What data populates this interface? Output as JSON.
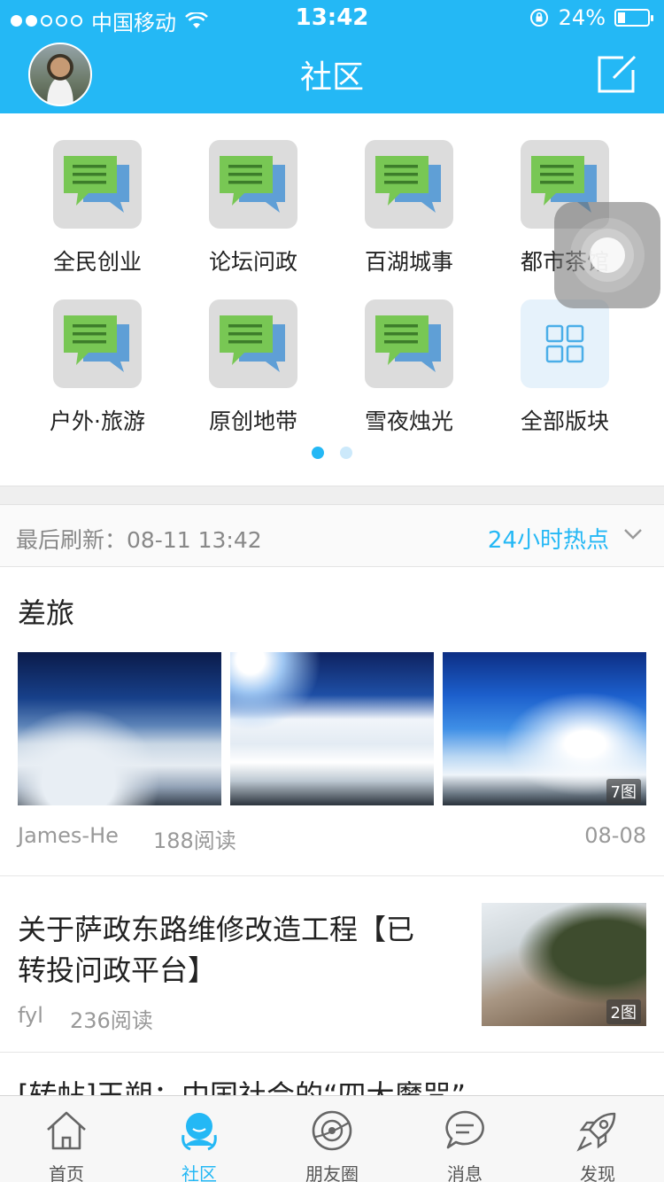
{
  "status_bar": {
    "carrier": "中国移动",
    "time": "13:42",
    "battery": "24%",
    "battery_level": 0.24,
    "signal_bars_filled": 2,
    "signal_bars_total": 5
  },
  "header": {
    "title": "社区",
    "brand_color": "#24b8f5",
    "avatar_icon": "user-avatar",
    "compose_icon": "edit-icon"
  },
  "forums": {
    "items": [
      {
        "label": "全民创业",
        "icon": "chat-bubbles-icon"
      },
      {
        "label": "论坛问政",
        "icon": "chat-bubbles-icon"
      },
      {
        "label": "百湖城事",
        "icon": "chat-bubbles-icon"
      },
      {
        "label": "都市茶馆",
        "icon": "chat-bubbles-icon"
      },
      {
        "label": "户外·旅游",
        "icon": "chat-bubbles-icon"
      },
      {
        "label": "原创地带",
        "icon": "chat-bubbles-icon"
      },
      {
        "label": "雪夜烛光",
        "icon": "chat-bubbles-icon"
      },
      {
        "label": "全部版块",
        "icon": "grid-icon"
      }
    ],
    "pages": 2,
    "current_page": 1
  },
  "refresh_bar": {
    "last_refresh": "最后刷新：08-11  13:42",
    "filter": "24小时热点"
  },
  "feed": {
    "post1": {
      "title": "差旅",
      "author": "James-He",
      "reads": "188阅读",
      "date": "08-08",
      "image_count": "7图"
    },
    "post2": {
      "title_line1": "关于萨政东路维修改造工程【已",
      "title_line2": "转投问政平台】",
      "author": "fyl",
      "reads": "236阅读",
      "image_count": "2图"
    },
    "post3": {
      "title": "[转帖]王朔：中国社会的“四大魔咒”"
    }
  },
  "tabbar": {
    "items": [
      {
        "label": "首页",
        "icon": "home-icon"
      },
      {
        "label": "社区",
        "icon": "community-icon",
        "active": true
      },
      {
        "label": "朋友圈",
        "icon": "friends-circle-icon"
      },
      {
        "label": "消息",
        "icon": "message-icon"
      },
      {
        "label": "发现",
        "icon": "rocket-icon"
      }
    ]
  }
}
